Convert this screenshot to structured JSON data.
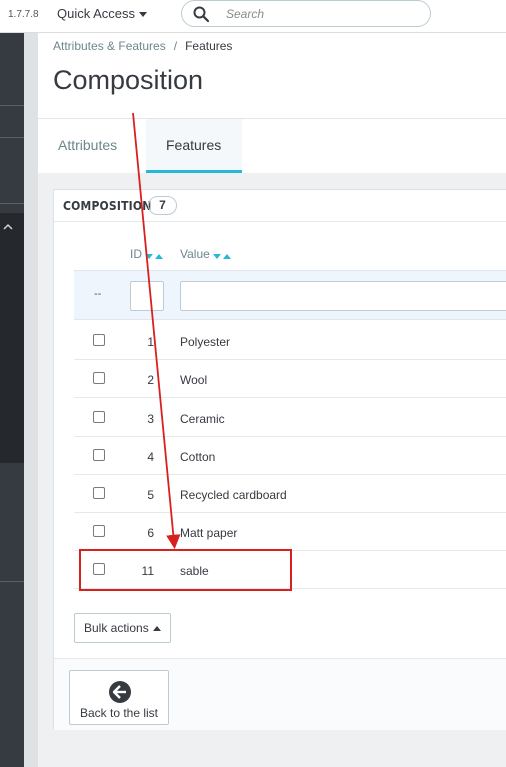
{
  "header": {
    "version": "1.7.7.8",
    "quick_access_label": "Quick Access",
    "search_placeholder": "Search"
  },
  "breadcrumb": {
    "parent": "Attributes & Features",
    "separator": "/",
    "current": "Features"
  },
  "page": {
    "title": "Composition"
  },
  "tabs": [
    {
      "label": "Attributes",
      "active": false
    },
    {
      "label": "Features",
      "active": true
    }
  ],
  "panel": {
    "title": "COMPOSITION",
    "count": "7",
    "columns": {
      "id": "ID",
      "value": "Value"
    },
    "filter_placeholder": "--",
    "rows": [
      {
        "id": "1",
        "value": "Polyester"
      },
      {
        "id": "2",
        "value": "Wool"
      },
      {
        "id": "3",
        "value": "Ceramic"
      },
      {
        "id": "4",
        "value": "Cotton"
      },
      {
        "id": "5",
        "value": "Recycled cardboard"
      },
      {
        "id": "6",
        "value": "Matt paper"
      },
      {
        "id": "11",
        "value": "sable"
      }
    ],
    "bulk_actions_label": "Bulk actions",
    "back_label": "Back to the list"
  },
  "colors": {
    "accent": "#25b9d7",
    "sidebar": "#363a41",
    "annotation": "#d8201f"
  }
}
